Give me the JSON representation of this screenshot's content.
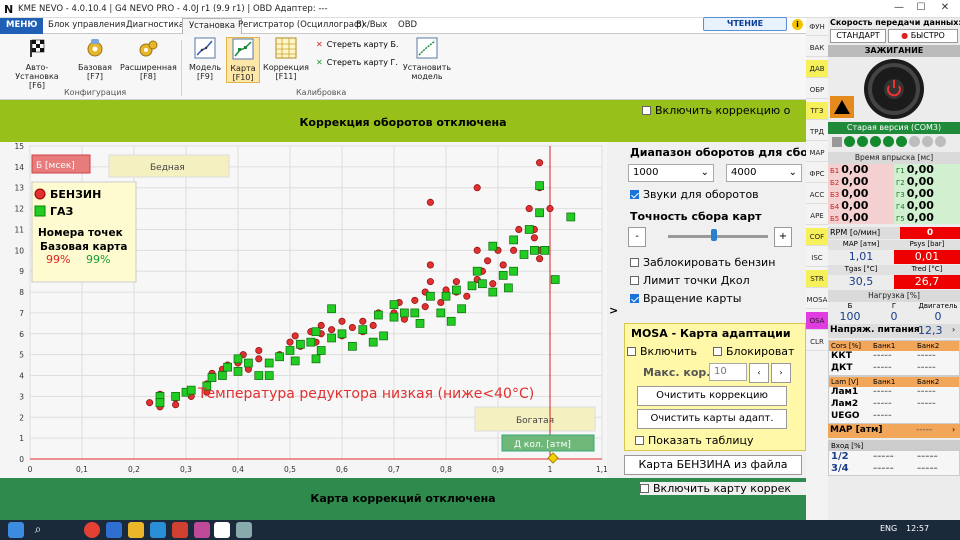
{
  "window": {
    "icon": "N",
    "title": "KME NEVO - 4.0.10.4  |  G4 NEVO PRO - 4.0J r1 (9.9 r1)  |  OBD Адаптер: ---",
    "min": "—",
    "max": "☐",
    "close": "✕"
  },
  "menu": {
    "file": "МЕНЮ",
    "tabs": [
      "Блок управления",
      "Диагностика",
      "Установка",
      "Регистратор (Осциллограф)",
      "Вх/Вых",
      "OBD"
    ],
    "active_tab": "Установка",
    "mode_chip": "ЧТЕНИЕ",
    "info": "i"
  },
  "ribbon": {
    "config_group": "Конфигурация",
    "calib_group": "Калибровка",
    "buttons": [
      {
        "l1": "Авто-Установка",
        "l2": "[F6]",
        "icon": "checkered-flag-icon"
      },
      {
        "l1": "Базовая",
        "l2": "[F7]",
        "icon": "gear-yellow-icon"
      },
      {
        "l1": "Расширенная",
        "l2": "[F8]",
        "icon": "gears-yellow-icon"
      },
      {
        "l1": "Модель",
        "l2": "[F9]",
        "icon": "model-graph-icon"
      },
      {
        "l1": "Карта",
        "l2": "[F10]",
        "icon": "map-graph-icon"
      },
      {
        "l1": "Коррекция",
        "l2": "[F11]",
        "icon": "correction-table-icon"
      },
      {
        "l1": "Установить",
        "l2": "модель",
        "icon": "set-model-icon"
      }
    ],
    "erase_b": "Стереть карту Б.",
    "erase_g": "Стереть карту Г."
  },
  "top_band": {
    "text": "Коррекция оборотов отключена",
    "checkbox": "Включить коррекцию о"
  },
  "bottom_band": {
    "text": "Карта коррекций отключена",
    "checkbox": "Включить карту коррек"
  },
  "chart_data": {
    "type": "scatter",
    "xlim": [
      0,
      1.1
    ],
    "ylim": [
      0,
      15
    ],
    "xticks": [
      "0",
      "0,1",
      "0,2",
      "0,3",
      "0,4",
      "0,5",
      "0,6",
      "0,7",
      "0,8",
      "0,9",
      "1",
      "1,1"
    ],
    "yticks": [
      "0",
      "1",
      "2",
      "3",
      "4",
      "5",
      "6",
      "7",
      "8",
      "9",
      "10",
      "11",
      "12",
      "13",
      "14",
      "15"
    ],
    "ylabel": "Б [мсек]",
    "xlabel": "Д кол. [атм]",
    "zone_lean": "Бедная",
    "zone_rich": "Богатая",
    "warning": "Температура редуктора низкая (ниже<40°С)",
    "legend": {
      "petrol": "БЕНЗИН",
      "gas": "ГАЗ",
      "points_title": "Номера точек",
      "base_map": "Базовая карта",
      "petrol_pct": "99%",
      "gas_pct": "99%"
    },
    "vline_x": 1.0,
    "series": [
      {
        "name": "БЕНЗИН",
        "color": "#e03030",
        "shape": "circle",
        "points": [
          [
            0.23,
            2.7
          ],
          [
            0.25,
            2.5
          ],
          [
            0.25,
            2.9
          ],
          [
            0.25,
            3.1
          ],
          [
            0.28,
            2.6
          ],
          [
            0.28,
            2.9
          ],
          [
            0.31,
            3.0
          ],
          [
            0.34,
            3.2
          ],
          [
            0.34,
            3.6
          ],
          [
            0.35,
            4.1
          ],
          [
            0.37,
            4.3
          ],
          [
            0.38,
            4.5
          ],
          [
            0.4,
            4.6
          ],
          [
            0.41,
            5.0
          ],
          [
            0.42,
            4.3
          ],
          [
            0.44,
            5.2
          ],
          [
            0.44,
            4.8
          ],
          [
            0.46,
            4.6
          ],
          [
            0.48,
            5.0
          ],
          [
            0.5,
            5.6
          ],
          [
            0.5,
            5.2
          ],
          [
            0.51,
            5.9
          ],
          [
            0.52,
            5.4
          ],
          [
            0.54,
            6.1
          ],
          [
            0.55,
            5.6
          ],
          [
            0.56,
            6.0
          ],
          [
            0.56,
            6.4
          ],
          [
            0.58,
            6.2
          ],
          [
            0.6,
            6.6
          ],
          [
            0.6,
            5.9
          ],
          [
            0.62,
            6.3
          ],
          [
            0.64,
            6.1
          ],
          [
            0.64,
            6.6
          ],
          [
            0.66,
            6.4
          ],
          [
            0.67,
            7.0
          ],
          [
            0.7,
            7.0
          ],
          [
            0.71,
            7.5
          ],
          [
            0.72,
            6.7
          ],
          [
            0.74,
            7.6
          ],
          [
            0.76,
            7.3
          ],
          [
            0.76,
            8.0
          ],
          [
            0.77,
            8.5
          ],
          [
            0.77,
            9.3
          ],
          [
            0.77,
            12.3
          ],
          [
            0.79,
            7.5
          ],
          [
            0.8,
            8.1
          ],
          [
            0.82,
            8.0
          ],
          [
            0.82,
            8.5
          ],
          [
            0.84,
            7.8
          ],
          [
            0.86,
            8.6
          ],
          [
            0.86,
            10.0
          ],
          [
            0.86,
            13.0
          ],
          [
            0.87,
            9.0
          ],
          [
            0.88,
            9.5
          ],
          [
            0.89,
            8.4
          ],
          [
            0.9,
            10.0
          ],
          [
            0.91,
            9.3
          ],
          [
            0.93,
            10.0
          ],
          [
            0.94,
            11.0
          ],
          [
            0.95,
            9.8
          ],
          [
            0.96,
            12.0
          ],
          [
            0.97,
            10.6
          ],
          [
            0.97,
            11.0
          ],
          [
            0.98,
            13.0
          ],
          [
            0.98,
            10.0
          ],
          [
            0.98,
            9.6
          ],
          [
            0.98,
            14.2
          ],
          [
            1.0,
            12.0
          ]
        ]
      },
      {
        "name": "ГАЗ",
        "color": "#22cc22",
        "shape": "square",
        "points": [
          [
            0.25,
            3.0
          ],
          [
            0.25,
            2.7
          ],
          [
            0.28,
            3.0
          ],
          [
            0.3,
            3.2
          ],
          [
            0.31,
            3.3
          ],
          [
            0.34,
            3.5
          ],
          [
            0.35,
            3.9
          ],
          [
            0.37,
            4.0
          ],
          [
            0.38,
            4.4
          ],
          [
            0.4,
            4.2
          ],
          [
            0.4,
            4.8
          ],
          [
            0.42,
            4.6
          ],
          [
            0.44,
            4.0
          ],
          [
            0.46,
            4.6
          ],
          [
            0.46,
            4.0
          ],
          [
            0.48,
            4.9
          ],
          [
            0.5,
            5.2
          ],
          [
            0.51,
            4.7
          ],
          [
            0.52,
            5.5
          ],
          [
            0.54,
            5.6
          ],
          [
            0.55,
            4.8
          ],
          [
            0.55,
            6.1
          ],
          [
            0.56,
            5.2
          ],
          [
            0.58,
            5.8
          ],
          [
            0.58,
            7.2
          ],
          [
            0.6,
            6.0
          ],
          [
            0.62,
            5.4
          ],
          [
            0.64,
            6.2
          ],
          [
            0.66,
            5.6
          ],
          [
            0.67,
            6.9
          ],
          [
            0.68,
            5.9
          ],
          [
            0.7,
            6.8
          ],
          [
            0.7,
            7.4
          ],
          [
            0.72,
            7.0
          ],
          [
            0.74,
            7.0
          ],
          [
            0.75,
            6.5
          ],
          [
            0.77,
            7.8
          ],
          [
            0.79,
            7.0
          ],
          [
            0.8,
            7.8
          ],
          [
            0.81,
            6.6
          ],
          [
            0.82,
            8.1
          ],
          [
            0.83,
            7.2
          ],
          [
            0.85,
            8.3
          ],
          [
            0.86,
            9.0
          ],
          [
            0.87,
            8.4
          ],
          [
            0.89,
            8.0
          ],
          [
            0.89,
            10.2
          ],
          [
            0.91,
            8.8
          ],
          [
            0.92,
            8.2
          ],
          [
            0.93,
            9.0
          ],
          [
            0.93,
            10.5
          ],
          [
            0.95,
            9.8
          ],
          [
            0.96,
            11.0
          ],
          [
            0.97,
            10.0
          ],
          [
            0.98,
            11.8
          ],
          [
            0.98,
            13.1
          ],
          [
            0.99,
            10.0
          ],
          [
            1.01,
            8.6
          ],
          [
            1.04,
            11.6
          ]
        ]
      }
    ]
  },
  "right_panel": {
    "rpm_range": "Диапазон оборотов для сбо",
    "rpm_from": "1000",
    "rpm_to": "4000",
    "sounds": "Звуки для оборотов",
    "accuracy": "Точность сбора карт",
    "minus": "-",
    "plus": "+",
    "lock_petrol": "Заблокировать бензин",
    "limit": "Лимит точки Дкол",
    "rotate": "Вращение карты",
    "mosa_title": "MOSA - Карта адаптации",
    "enable": "Включить",
    "block": "Блокироват",
    "max_cor": "Макс. кор.",
    "max_cor_val": "10",
    "clear_cor": "Очистить коррекцию",
    "clear_maps": "Очистить карты адапт.",
    "show_table": "Показать таблицу",
    "petrol_map": "Карта БЕНЗИНА из файла",
    "arrow": ">"
  },
  "sidebar": [
    "ФУН",
    "ВАК",
    "ДАВ",
    "ОБР",
    "ТГЗ",
    "ТРД",
    "МАР",
    "ФРС",
    "АСС",
    "АРЕ",
    "COF",
    "ISC",
    "STR",
    "MOSA",
    "OSA",
    "CLR"
  ],
  "dash": {
    "speed_title": "Скорость передачи данных:",
    "std": "СТАНДАРТ",
    "fast": "БЫСТРО",
    "ignition": "ЗАЖИГАНИЕ",
    "old_version": "Старая версия (COM3)",
    "inj_title": "Время впрыска [мс]",
    "b": [
      [
        "Б1",
        "0,00"
      ],
      [
        "Б2",
        "0,00"
      ],
      [
        "Б3",
        "0,00"
      ],
      [
        "Б4",
        "0,00"
      ],
      [
        "Б5",
        "0,00"
      ]
    ],
    "g": [
      [
        "Г1",
        "0,00"
      ],
      [
        "Г2",
        "0,00"
      ],
      [
        "Г3",
        "0,00"
      ],
      [
        "Г4",
        "0,00"
      ],
      [
        "Г5",
        "0,00"
      ]
    ],
    "rpm_label": "RPM [о/мин]",
    "rpm": "0",
    "map_label": "МАР [атм]",
    "map": "1,01",
    "psys_label": "Psys [bar]",
    "psys": "0,01",
    "tgas_label": "Tgas [°C]",
    "tgas": "30,5",
    "tred_label": "Tred [°C]",
    "tred": "26,7",
    "load_title": "Нагрузка [%]",
    "load_b": "Б",
    "load_g": "Г",
    "load_e": "Двигатель",
    "load_b_val": "100",
    "load_g_val": "0",
    "load_e_val": "0",
    "volt_label": "Напряж. питания",
    "volt": "12,3",
    "cors_title": "Cors [%]",
    "bank1": "Банк1",
    "bank2": "Банк2",
    "kkt": "ККТ",
    "dkt": "ДКТ",
    "dash": "-----",
    "lam_title": "Lam [V]",
    "lam1": "Лам1",
    "lam2": "Лам2",
    "uego": "UEGO",
    "map2": "МАР [атм]",
    "inp_title": "Вход [%]",
    "in12": "1/2",
    "in34": "3/4"
  },
  "taskbar": {
    "lang": "ENG",
    "time": "12:57"
  }
}
